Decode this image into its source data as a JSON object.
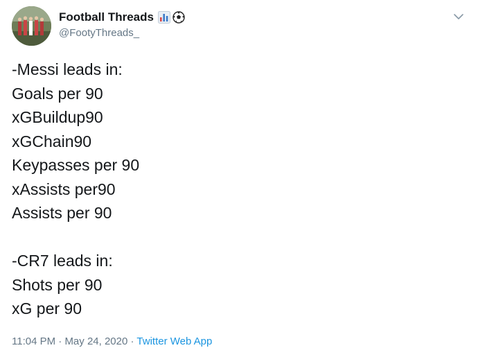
{
  "author": {
    "display_name": "Football Threads",
    "handle": "@FootyThreads_",
    "emoji_icons": [
      "bar-chart-icon",
      "soccer-ball-icon"
    ]
  },
  "tweet": {
    "section1": {
      "heading": "-Messi leads in:",
      "items": [
        "Goals per 90",
        "xGBuildup90",
        "xGChain90",
        "Keypasses per 90",
        "xAssists per90",
        "Assists per 90"
      ]
    },
    "section2": {
      "heading": "-CR7 leads in:",
      "items": [
        "Shots per 90",
        "xG per 90"
      ]
    }
  },
  "meta": {
    "time": "11:04 PM",
    "date": "May 24, 2020",
    "separator": "·",
    "source": "Twitter Web App"
  },
  "colors": {
    "text": "#14171a",
    "secondary": "#657786",
    "link": "#1b95e0"
  }
}
